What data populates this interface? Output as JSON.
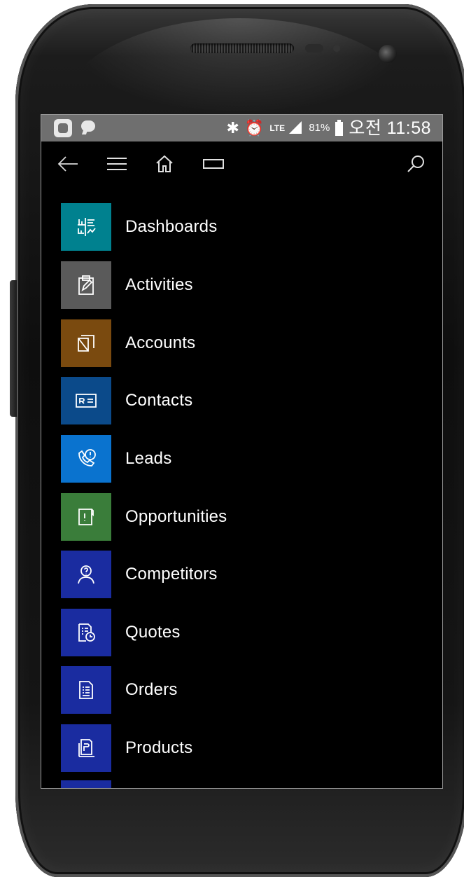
{
  "status_bar": {
    "left_icons": [
      "app-notification-icon",
      "chat-notification-icon"
    ],
    "right_icons": [
      "bluetooth-icon",
      "alarm-icon",
      "lte-icon",
      "signal-icon"
    ],
    "lte": "LTE",
    "battery_percent": "81%",
    "time": "오전 11:58"
  },
  "toolbar": {
    "icons": [
      "back-arrow-icon",
      "hamburger-menu-icon",
      "home-icon",
      "tabs-icon",
      "search-icon"
    ]
  },
  "entities": [
    {
      "label": "Dashboards",
      "color": "#00818f",
      "icon": "dashboard-icon"
    },
    {
      "label": "Activities",
      "color": "#5a5a5a",
      "icon": "clipboard-icon"
    },
    {
      "label": "Accounts",
      "color": "#7a4a0f",
      "icon": "account-icon"
    },
    {
      "label": "Contacts",
      "color": "#0b4a8a",
      "icon": "contact-card-icon"
    },
    {
      "label": "Leads",
      "color": "#0a73cf",
      "icon": "phone-alert-icon"
    },
    {
      "label": "Opportunities",
      "color": "#3a7d3a",
      "icon": "opportunity-icon"
    },
    {
      "label": "Competitors",
      "color": "#1a2ca0",
      "icon": "competitor-icon"
    },
    {
      "label": "Quotes",
      "color": "#1a2ca0",
      "icon": "quote-icon"
    },
    {
      "label": "Orders",
      "color": "#1a2ca0",
      "icon": "order-icon"
    },
    {
      "label": "Products",
      "color": "#1a2ca0",
      "icon": "product-icon"
    }
  ],
  "next_tile_color": "#1a2ca0"
}
